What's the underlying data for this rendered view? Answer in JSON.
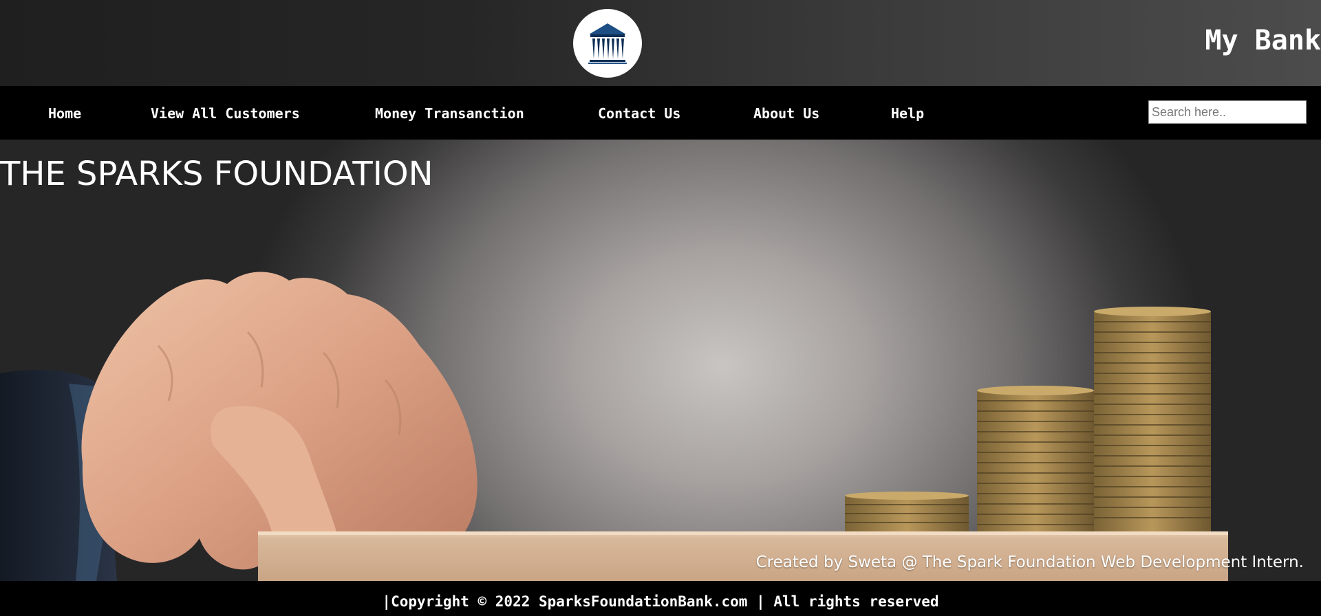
{
  "header": {
    "logo_icon": "bank-building-icon",
    "brand": "My Bank"
  },
  "nav": {
    "items": [
      {
        "label": "Home"
      },
      {
        "label": "View All Customers"
      },
      {
        "label": "Money Transanction"
      },
      {
        "label": "Contact Us"
      },
      {
        "label": "About Us"
      },
      {
        "label": "Help"
      }
    ],
    "search_placeholder": "Search here.."
  },
  "hero": {
    "title": "THE SPARKS FOUNDATION",
    "credit": "Created by Sweta @ The Spark Foundation Web Development Intern."
  },
  "footer": {
    "copyright": "|Copyright © 2022 SparksFoundationBank.com | All rights reserved"
  },
  "colors": {
    "logo_blue": "#1d4f85",
    "nav_bg": "#000000",
    "text": "#ffffff"
  }
}
